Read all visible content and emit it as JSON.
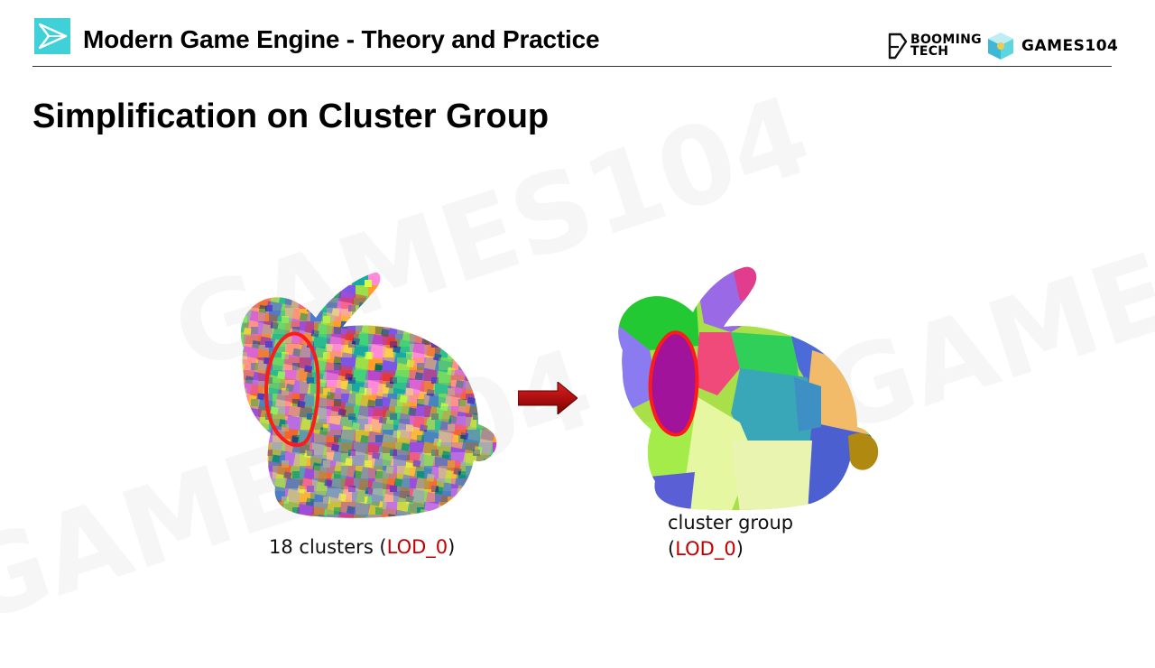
{
  "header": {
    "title": "Modern Game Engine - Theory and Practice",
    "brand_booming_line1": "BOOMING",
    "brand_booming_line2": "TECH",
    "brand_games": "GAMES104"
  },
  "slide": {
    "title": "Simplification on Cluster Group"
  },
  "figure_left": {
    "caption_prefix": "18 clusters (",
    "caption_lod": "LOD_0",
    "caption_suffix": ")"
  },
  "figure_right": {
    "caption_line1": "cluster group",
    "caption_open": "(",
    "caption_lod": "LOD_0",
    "caption_close": ")"
  },
  "colors": {
    "accent_red": "#c00000",
    "highlight_outline": "#ff1a1a",
    "logo_cyan": "#3fd0d8"
  }
}
